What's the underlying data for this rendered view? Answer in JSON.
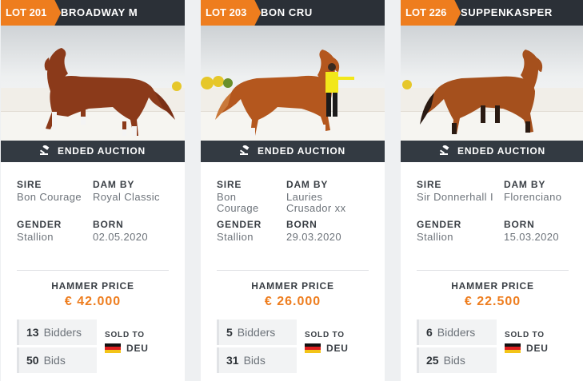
{
  "status_text": "ENDED AUCTION",
  "labels": {
    "sire": "SIRE",
    "dam_by": "DAM BY",
    "gender": "GENDER",
    "born": "BORN",
    "hammer_price": "HAMMER PRICE",
    "sold_to": "SOLD TO",
    "bidders": "Bidders",
    "bids": "Bids"
  },
  "colors": {
    "accent": "#ee7d1e",
    "header_bg": "#2b3037",
    "status_bg": "#333a42"
  },
  "icons": {
    "status": "gavel-icon",
    "flag": "germany-flag-icon"
  },
  "lots": [
    {
      "lot": "LOT 201",
      "name": "BROADWAY M",
      "sire": "Bon Courage",
      "dam_by": "Royal Classic",
      "gender": "Stallion",
      "born": "02.05.2020",
      "price": "€ 42.000",
      "bidders": "13",
      "bids": "50",
      "country": "DEU"
    },
    {
      "lot": "LOT 203",
      "name": "BON CRU",
      "sire": "Bon\nCourage",
      "dam_by": "Lauries\nCrusador xx",
      "gender": "Stallion",
      "born": "29.03.2020",
      "price": "€ 26.000",
      "bidders": "5",
      "bids": "31",
      "country": "DEU"
    },
    {
      "lot": "LOT 226",
      "name": "SUPPENKASPER",
      "sire": "Sir Donnerhall I",
      "dam_by": "Florenciano",
      "gender": "Stallion",
      "born": "15.03.2020",
      "price": "€ 22.500",
      "bidders": "6",
      "bids": "25",
      "country": "DEU"
    }
  ]
}
